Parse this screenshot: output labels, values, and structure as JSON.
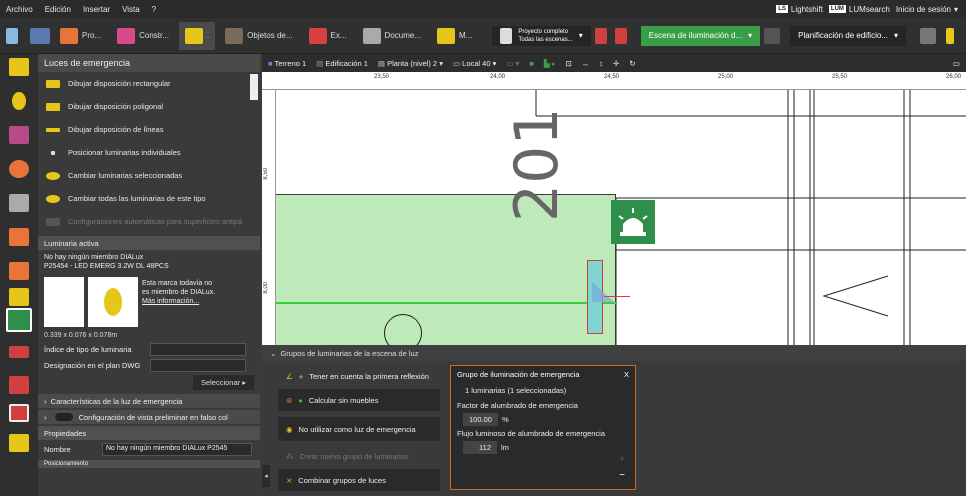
{
  "menu": [
    "Archivo",
    "Edición",
    "Insertar",
    "Vista",
    "?"
  ],
  "menu_right": {
    "lightshift": "Lightshift",
    "lumsearch": "LUMsearch",
    "login": "Inicio de sesión"
  },
  "toolbar": {
    "items": [
      "Pro...",
      "Constr...",
      ".",
      "Objetos de...",
      "Ex...",
      "Docume...",
      "M..."
    ],
    "project_line1": "Proyecto completo",
    "project_line2": "Todas las escenas...",
    "scene_select": "Escena de iluminación d...",
    "planning_select": "Planificación de edificio..."
  },
  "panel": {
    "title": "Luces de emergencia",
    "items": [
      "Dibujar disposición rectangular",
      "Dibujar disposición poligonal",
      "Dibujar disposición de líneas",
      "Posicionar luminarias individuales",
      "Cambiar luminarias seleccionadas",
      "Cambiar todas las luminarias de este tipo",
      "Configuraciones automáticas para superficies antipá"
    ],
    "active_header": "Luminaria activa",
    "active_line1": "No hay ningún miembro DIALux",
    "active_line2": "P25454 - LED EMERG 3.2W DL 48PCS",
    "notice_line1": "Esta marca todavía no",
    "notice_line2": "es miembro de DIALux.",
    "notice_link": "Más información...",
    "dimensions": "0.339 x 0.076 x 0.078m",
    "type_index_label": "Índice de tipo de luminaria",
    "dwg_label": "Designación en el plan DWG",
    "select_button": "Seleccionar",
    "emergency_props": "Características de la luz de emergencia",
    "preview_config": "Configuración de vista preliminar en falso col",
    "properties_header": "Propiedades",
    "name_label": "Nombre",
    "name_value": "No hay ningún miembro DIALux P2545",
    "bottom_cut": "Posicionamiento"
  },
  "viewbar": {
    "terrain": "Terreno 1",
    "building": "Edificación 1",
    "floor": "Planta (nivel) 2",
    "local": "Local 40"
  },
  "ruler": {
    "h": [
      "23,50",
      "24,00",
      "24,50",
      "25,00",
      "25,50",
      "26,00"
    ],
    "v": [
      "8,50",
      "8,00"
    ]
  },
  "canvas": {
    "room_number": "201"
  },
  "bottom": {
    "title": "Grupos de luminarias de la escena de luz",
    "buttons": [
      "Tener en cuenta la primera reflexión",
      "Calcular sin muebles",
      "No utilizar como luz de emergencia",
      "Crear nuevo grupo de luminarias",
      "Combinar grupos de luces"
    ]
  },
  "group_panel": {
    "title": "Grupo de iluminación de emergencia",
    "close": "X",
    "count": "1 luminarias (1 seleccionadas)",
    "factor_label": "Factor de alumbrado de emergencia",
    "factor_value": "100.00",
    "factor_unit": "%",
    "flux_label": "Flujo luminoso de alumbrado de emergencia",
    "flux_value": "112",
    "flux_unit": "lm",
    "plus": "+",
    "minus": "−"
  },
  "colors": {
    "accent": "#d4691c",
    "green": "#3a9e48",
    "room_fill": "#bdeab8"
  }
}
